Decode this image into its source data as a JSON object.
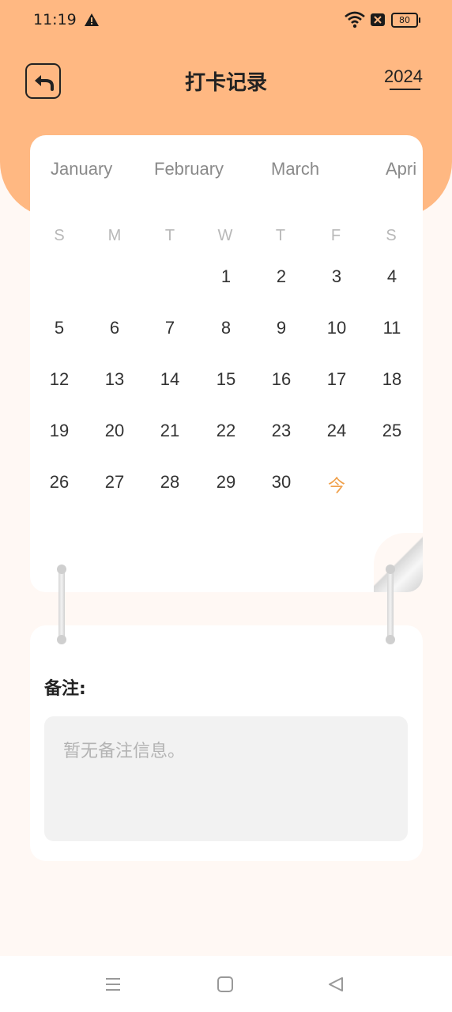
{
  "status_bar": {
    "time": "11:19",
    "battery": "80"
  },
  "header": {
    "title": "打卡记录",
    "year": "2024"
  },
  "calendar": {
    "months": [
      "January",
      "February",
      "March",
      "Apri"
    ],
    "weekdays": [
      "S",
      "M",
      "T",
      "W",
      "T",
      "F",
      "S"
    ],
    "days": [
      "1",
      "2",
      "3",
      "4",
      "5",
      "6",
      "7",
      "8",
      "9",
      "10",
      "11",
      "12",
      "13",
      "14",
      "15",
      "16",
      "17",
      "18",
      "19",
      "20",
      "21",
      "22",
      "23",
      "24",
      "25",
      "26",
      "27",
      "28",
      "29",
      "30"
    ],
    "today_label": "今"
  },
  "notes": {
    "title": "备注:",
    "placeholder": "暂无备注信息。"
  },
  "colors": {
    "header": "#ffb882",
    "accent": "#f0a04b",
    "background": "#fff8f4"
  },
  "icons": [
    "warning-icon",
    "wifi-icon",
    "sim-icon",
    "battery-icon",
    "back-arrow-icon",
    "menu-icon",
    "home-icon",
    "back-triangle-icon"
  ]
}
